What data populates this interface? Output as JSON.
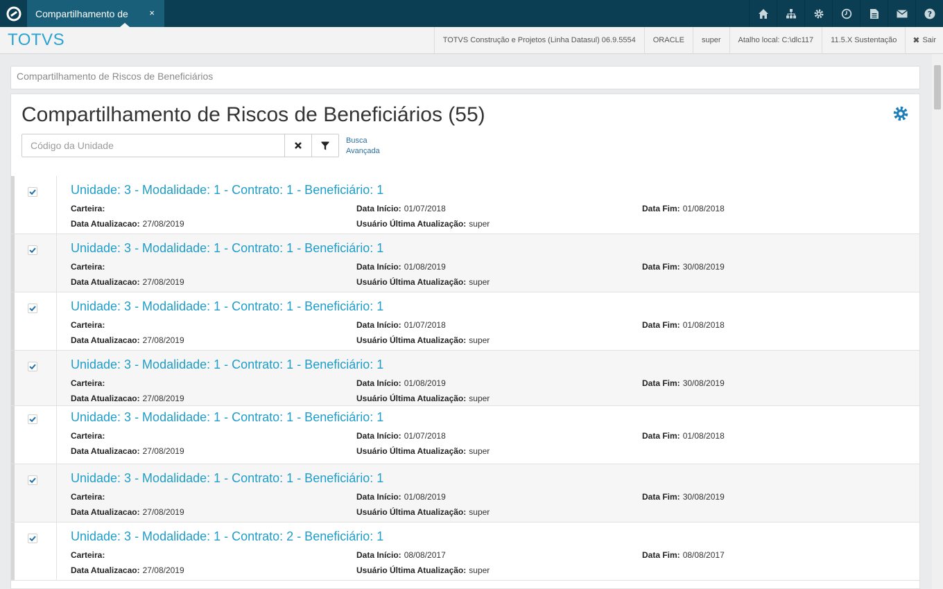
{
  "topbar": {
    "tab_title": "Compartilhamento de",
    "tab_close": "×",
    "icons": [
      "home-icon",
      "sitemap-icon",
      "gear-icon",
      "clock-icon",
      "document-icon",
      "mail-icon",
      "help-icon"
    ]
  },
  "header": {
    "brand": "TOTVS",
    "product": "TOTVS Construção e Projetos (Linha Datasul) 06.9.5554",
    "database": "ORACLE",
    "user": "super",
    "shortcut": "Atalho local: C:\\dlc117",
    "version": "11.5.X Sustentação",
    "exit_label": "Sair"
  },
  "breadcrumb": "Compartilhamento de Riscos de Beneficiários",
  "main": {
    "title": "Compartilhamento de Riscos de Beneficiários (55)",
    "search_placeholder": "Código da Unidade",
    "advanced_search_line1": "Busca",
    "advanced_search_line2": "Avançada"
  },
  "labels": {
    "carteira": "Carteira:",
    "data_inicio": "Data Início:",
    "data_fim": "Data Fim:",
    "data_atualizacao": "Data Atualizacao:",
    "usuario": "Usuário Última Atualização:"
  },
  "records": [
    {
      "title": "Unidade: 3 - Modalidade: 1 - Contrato: 1 - Beneficiário: 1",
      "carteira": "",
      "data_inicio": "01/07/2018",
      "data_fim": "01/08/2018",
      "data_atualizacao": "27/08/2019",
      "usuario": "super",
      "checked": true
    },
    {
      "title": "Unidade: 3 - Modalidade: 1 - Contrato: 1 - Beneficiário: 1",
      "carteira": "",
      "data_inicio": "01/08/2019",
      "data_fim": "30/08/2019",
      "data_atualizacao": "27/08/2019",
      "usuario": "super",
      "checked": true
    },
    {
      "title": "Unidade: 3 - Modalidade: 1 - Contrato: 1 - Beneficiário: 1",
      "carteira": "",
      "data_inicio": "01/07/2018",
      "data_fim": "01/08/2018",
      "data_atualizacao": "27/08/2019",
      "usuario": "super",
      "checked": true
    },
    {
      "title": "Unidade: 3 - Modalidade: 1 - Contrato: 1 - Beneficiário: 1",
      "carteira": "",
      "data_inicio": "01/08/2019",
      "data_fim": "30/08/2019",
      "data_atualizacao": "27/08/2019",
      "usuario": "super",
      "checked": true
    },
    {
      "title": "Unidade: 3 - Modalidade: 1 - Contrato: 1 - Beneficiário: 1",
      "carteira": "",
      "data_inicio": "01/07/2018",
      "data_fim": "01/08/2018",
      "data_atualizacao": "27/08/2019",
      "usuario": "super",
      "checked": true
    },
    {
      "title": "Unidade: 3 - Modalidade: 1 - Contrato: 1 - Beneficiário: 1",
      "carteira": "",
      "data_inicio": "01/08/2019",
      "data_fim": "30/08/2019",
      "data_atualizacao": "27/08/2019",
      "usuario": "super",
      "checked": true
    },
    {
      "title": "Unidade: 3 - Modalidade: 1 - Contrato: 2 - Beneficiário: 1",
      "carteira": "",
      "data_inicio": "08/08/2017",
      "data_fim": "08/08/2017",
      "data_atualizacao": "27/08/2019",
      "usuario": "super",
      "checked": true
    }
  ],
  "colors": {
    "topbar": "#0b3e52",
    "tab": "#1a5f79",
    "brand": "#29a3d1",
    "link": "#1e9dc8",
    "gear": "#1e7fb8"
  }
}
